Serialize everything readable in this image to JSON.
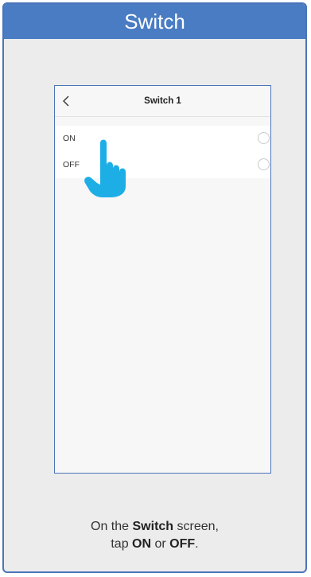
{
  "card": {
    "title": "Switch"
  },
  "phone": {
    "title": "Switch 1",
    "back_icon": "chevron-left-icon",
    "options": [
      {
        "label": "ON",
        "selected": false
      },
      {
        "label": "OFF",
        "selected": false
      }
    ]
  },
  "pointer_icon": "hand-pointer-icon",
  "caption": {
    "line1_prefix": "On the ",
    "line1_bold": "Switch",
    "line1_suffix": " screen,",
    "line2_prefix": "tap ",
    "line2_bold_on": "ON",
    "line2_mid": " or ",
    "line2_bold_off": "OFF",
    "line2_suffix": "."
  },
  "colors": {
    "accent": "#4a7cc4",
    "hand": "#1eaee6",
    "card_background": "#ececec"
  }
}
